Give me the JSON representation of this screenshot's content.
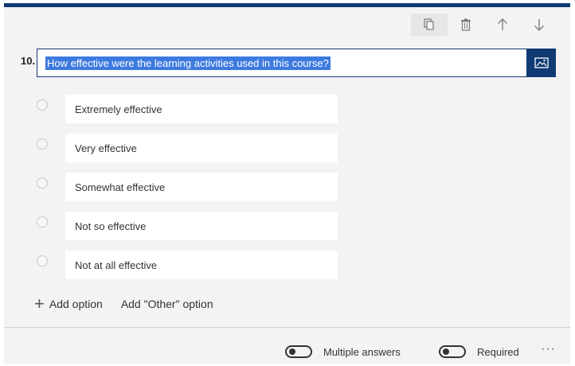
{
  "question": {
    "number": "10.",
    "text": "How effective were the learning activities used in this course?"
  },
  "options": [
    {
      "label": "Extremely effective"
    },
    {
      "label": "Very effective"
    },
    {
      "label": "Somewhat effective"
    },
    {
      "label": "Not so effective"
    },
    {
      "label": "Not at all effective"
    }
  ],
  "actions": {
    "add_option": "Add option",
    "add_other": "Add \"Other\" option"
  },
  "footer": {
    "multiple_answers": "Multiple answers",
    "required": "Required",
    "more": "···"
  },
  "colors": {
    "accent": "#0f3a73",
    "selection": "#3d7ae0",
    "card_bg": "#f3f3f3"
  }
}
